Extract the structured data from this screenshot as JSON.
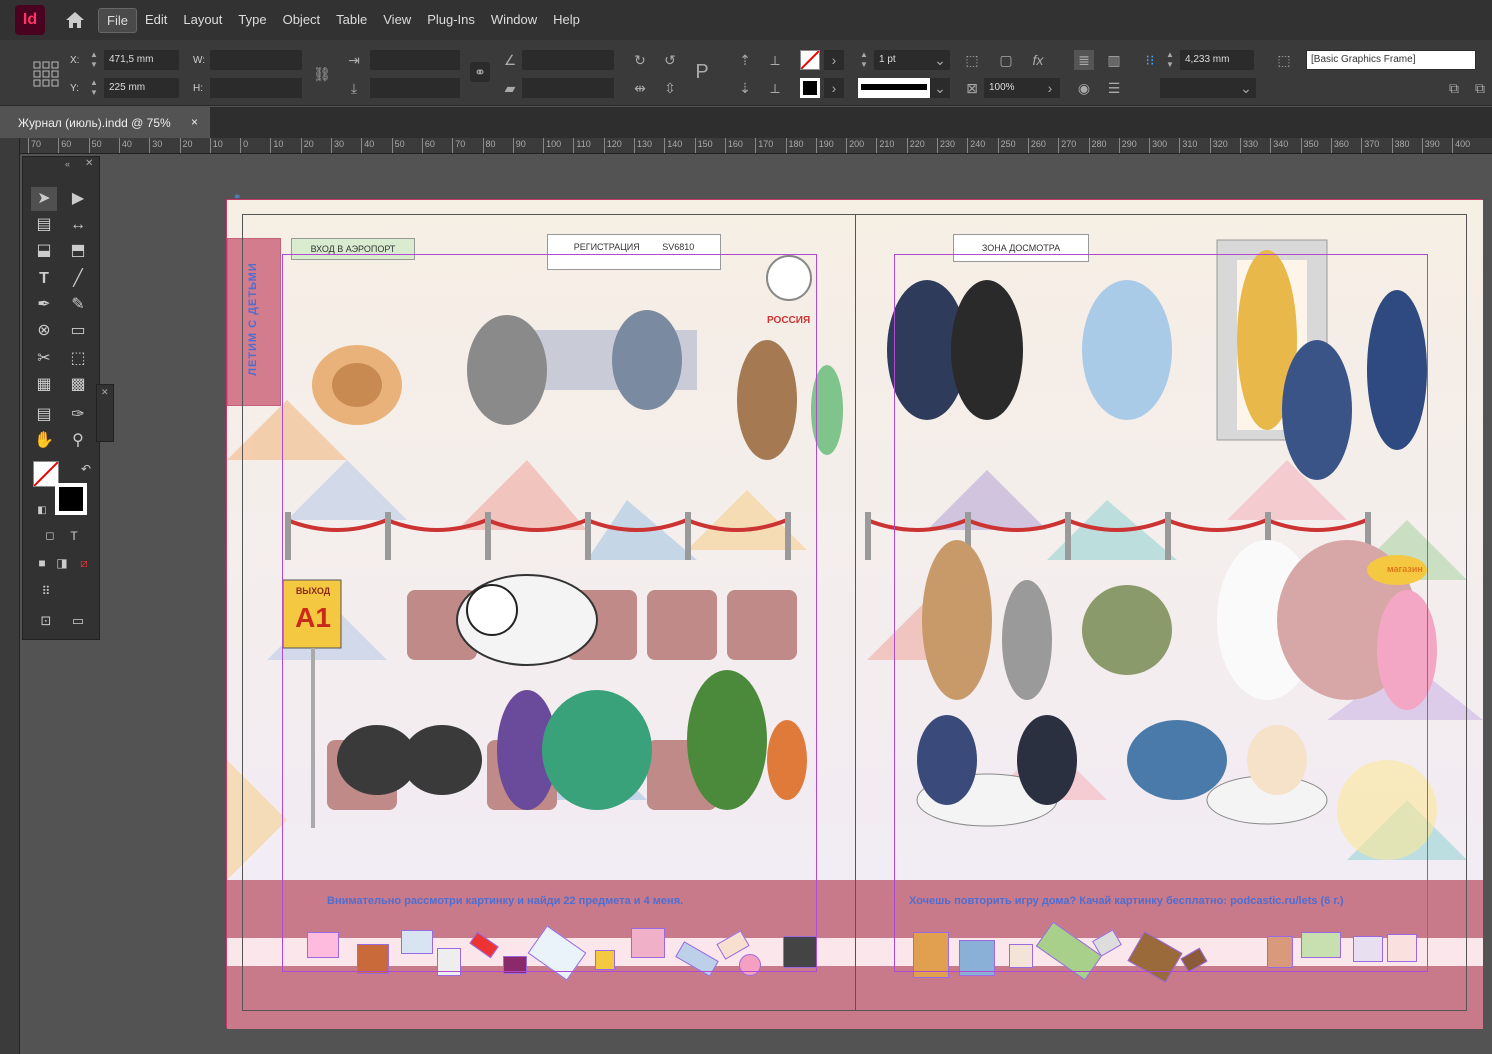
{
  "app": {
    "logo": "Id"
  },
  "menu": [
    "File",
    "Edit",
    "Layout",
    "Type",
    "Object",
    "Table",
    "View",
    "Plug-Ins",
    "Window",
    "Help"
  ],
  "control": {
    "x_label": "X:",
    "x_value": "471,5 mm",
    "y_label": "Y:",
    "y_value": "225 mm",
    "w_label": "W:",
    "h_label": "H:",
    "stroke_weight": "1 pt",
    "opacity": "100%",
    "offset": "4,233 mm",
    "object_style": "[Basic Graphics Frame]"
  },
  "tab": {
    "title": "Журнал (июль).indd @ 75%",
    "close": "×"
  },
  "ruler": [
    "70",
    "60",
    "50",
    "40",
    "30",
    "20",
    "10",
    "0",
    "10",
    "20",
    "30",
    "40",
    "50",
    "60",
    "70",
    "80",
    "90",
    "100",
    "110",
    "120",
    "130",
    "140",
    "150",
    "160",
    "170",
    "180",
    "190",
    "200",
    "210",
    "220",
    "230",
    "240",
    "250",
    "260",
    "270",
    "280",
    "290",
    "300",
    "310",
    "320",
    "330",
    "340",
    "350",
    "360",
    "370",
    "380",
    "390",
    "400"
  ],
  "page": {
    "vertical_title": "ЛЕТИМ С ДЕТЬМИ",
    "sign_entrance": "ВХОД В АЭРОПОРТ",
    "sign_registration": "РЕГИСТРАЦИЯ",
    "sign_flight": "SV6810",
    "sign_security": "ЗОНА ДОСМОТРА",
    "brand": "РОССИЯ",
    "gate_label": "ВЫХОД",
    "gate_code": "A1",
    "shop": "магазин",
    "caption_left": "Внимательно рассмотри картинку и найди 22 предмета и 4 меня.",
    "caption_right": "Хочешь повторить игру дома? Качай картинку бесплатно: podcastic.ru/lets (6 г.)"
  }
}
